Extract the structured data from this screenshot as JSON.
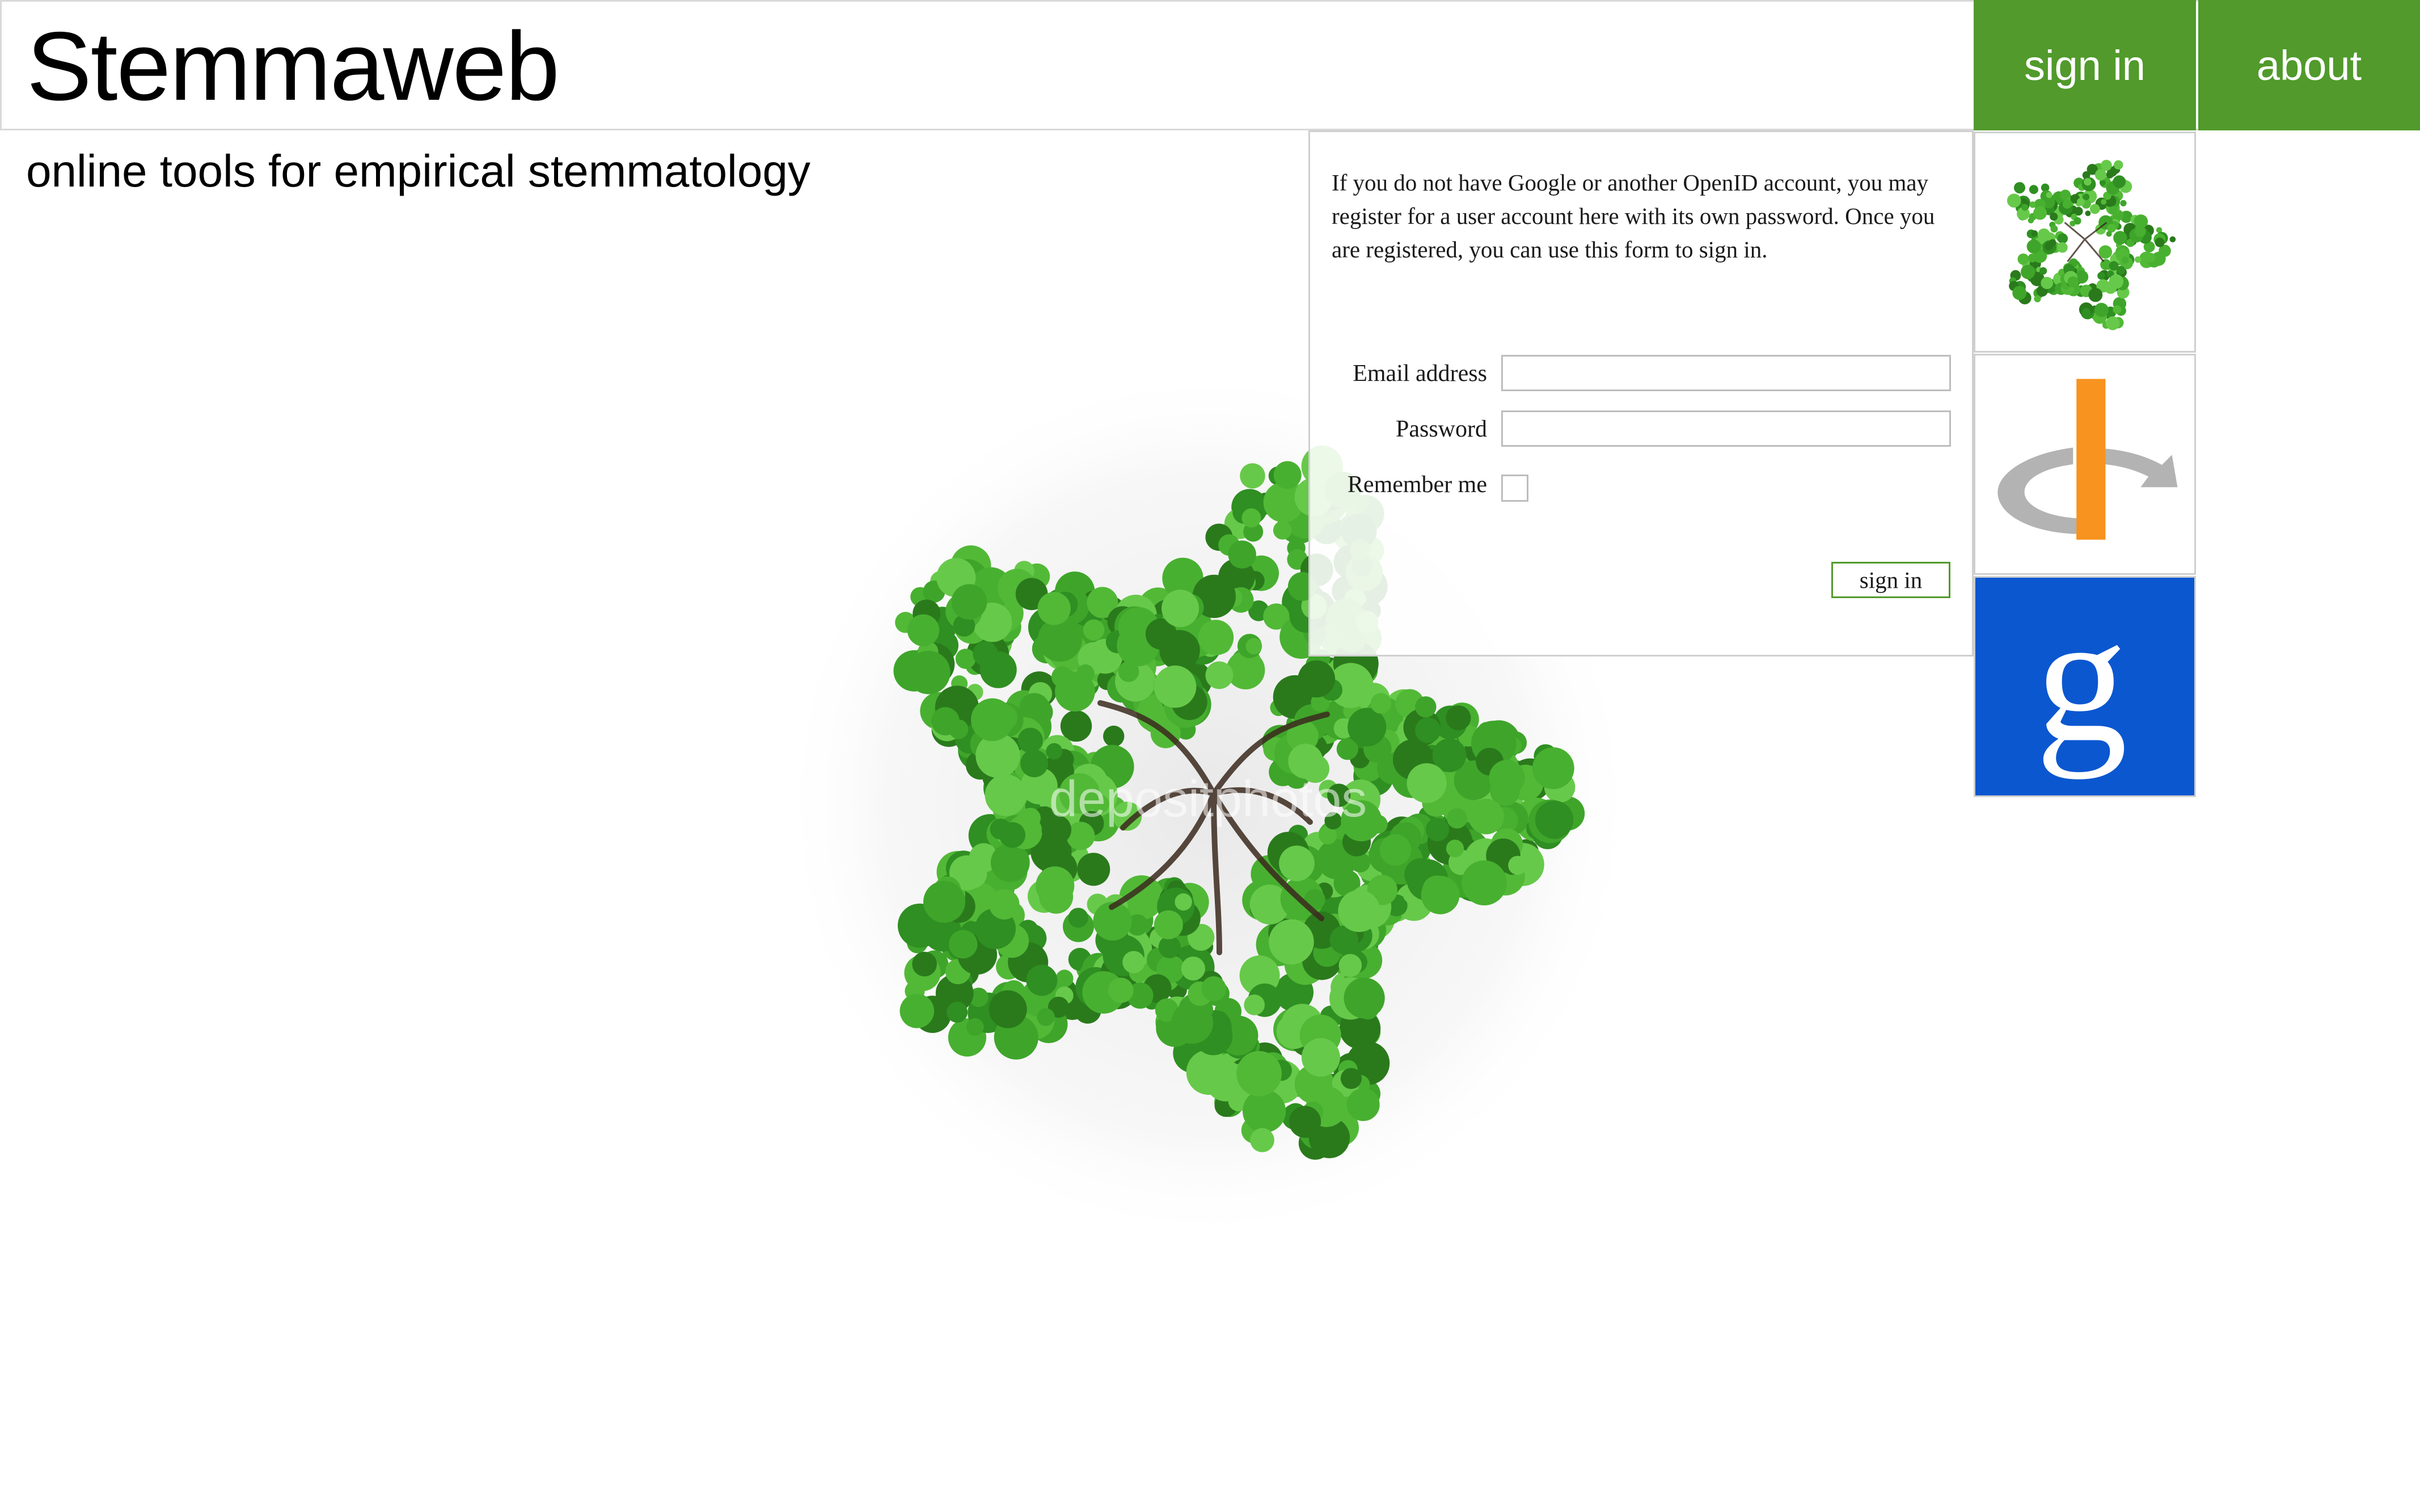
{
  "header": {
    "site_title": "Stemmaweb",
    "nav": [
      {
        "label": "sign in"
      },
      {
        "label": "about"
      }
    ]
  },
  "tagline": "online tools for empirical stemmatology",
  "watermark": "depositphotos",
  "login": {
    "intro": "If you do not have Google or another OpenID account, you may register for a user account here with its own password. Once you are registered, you can use this form to sign in.",
    "email_label": "Email address",
    "email_value": "",
    "password_label": "Password",
    "password_value": "",
    "remember_label": "Remember me",
    "remember_checked": false,
    "submit_label": "sign in"
  },
  "providers": [
    {
      "name": "stemmaweb",
      "icon": "tree-icon"
    },
    {
      "name": "openid",
      "icon": "openid-icon"
    },
    {
      "name": "google",
      "icon": "google-g-icon",
      "glyph": "g"
    }
  ],
  "colors": {
    "brand_green": "#519a2b",
    "google_blue": "#0b57d0",
    "openid_orange": "#f7931e",
    "openid_gray": "#b3b3b3",
    "foliage": "#3a9a2a"
  }
}
